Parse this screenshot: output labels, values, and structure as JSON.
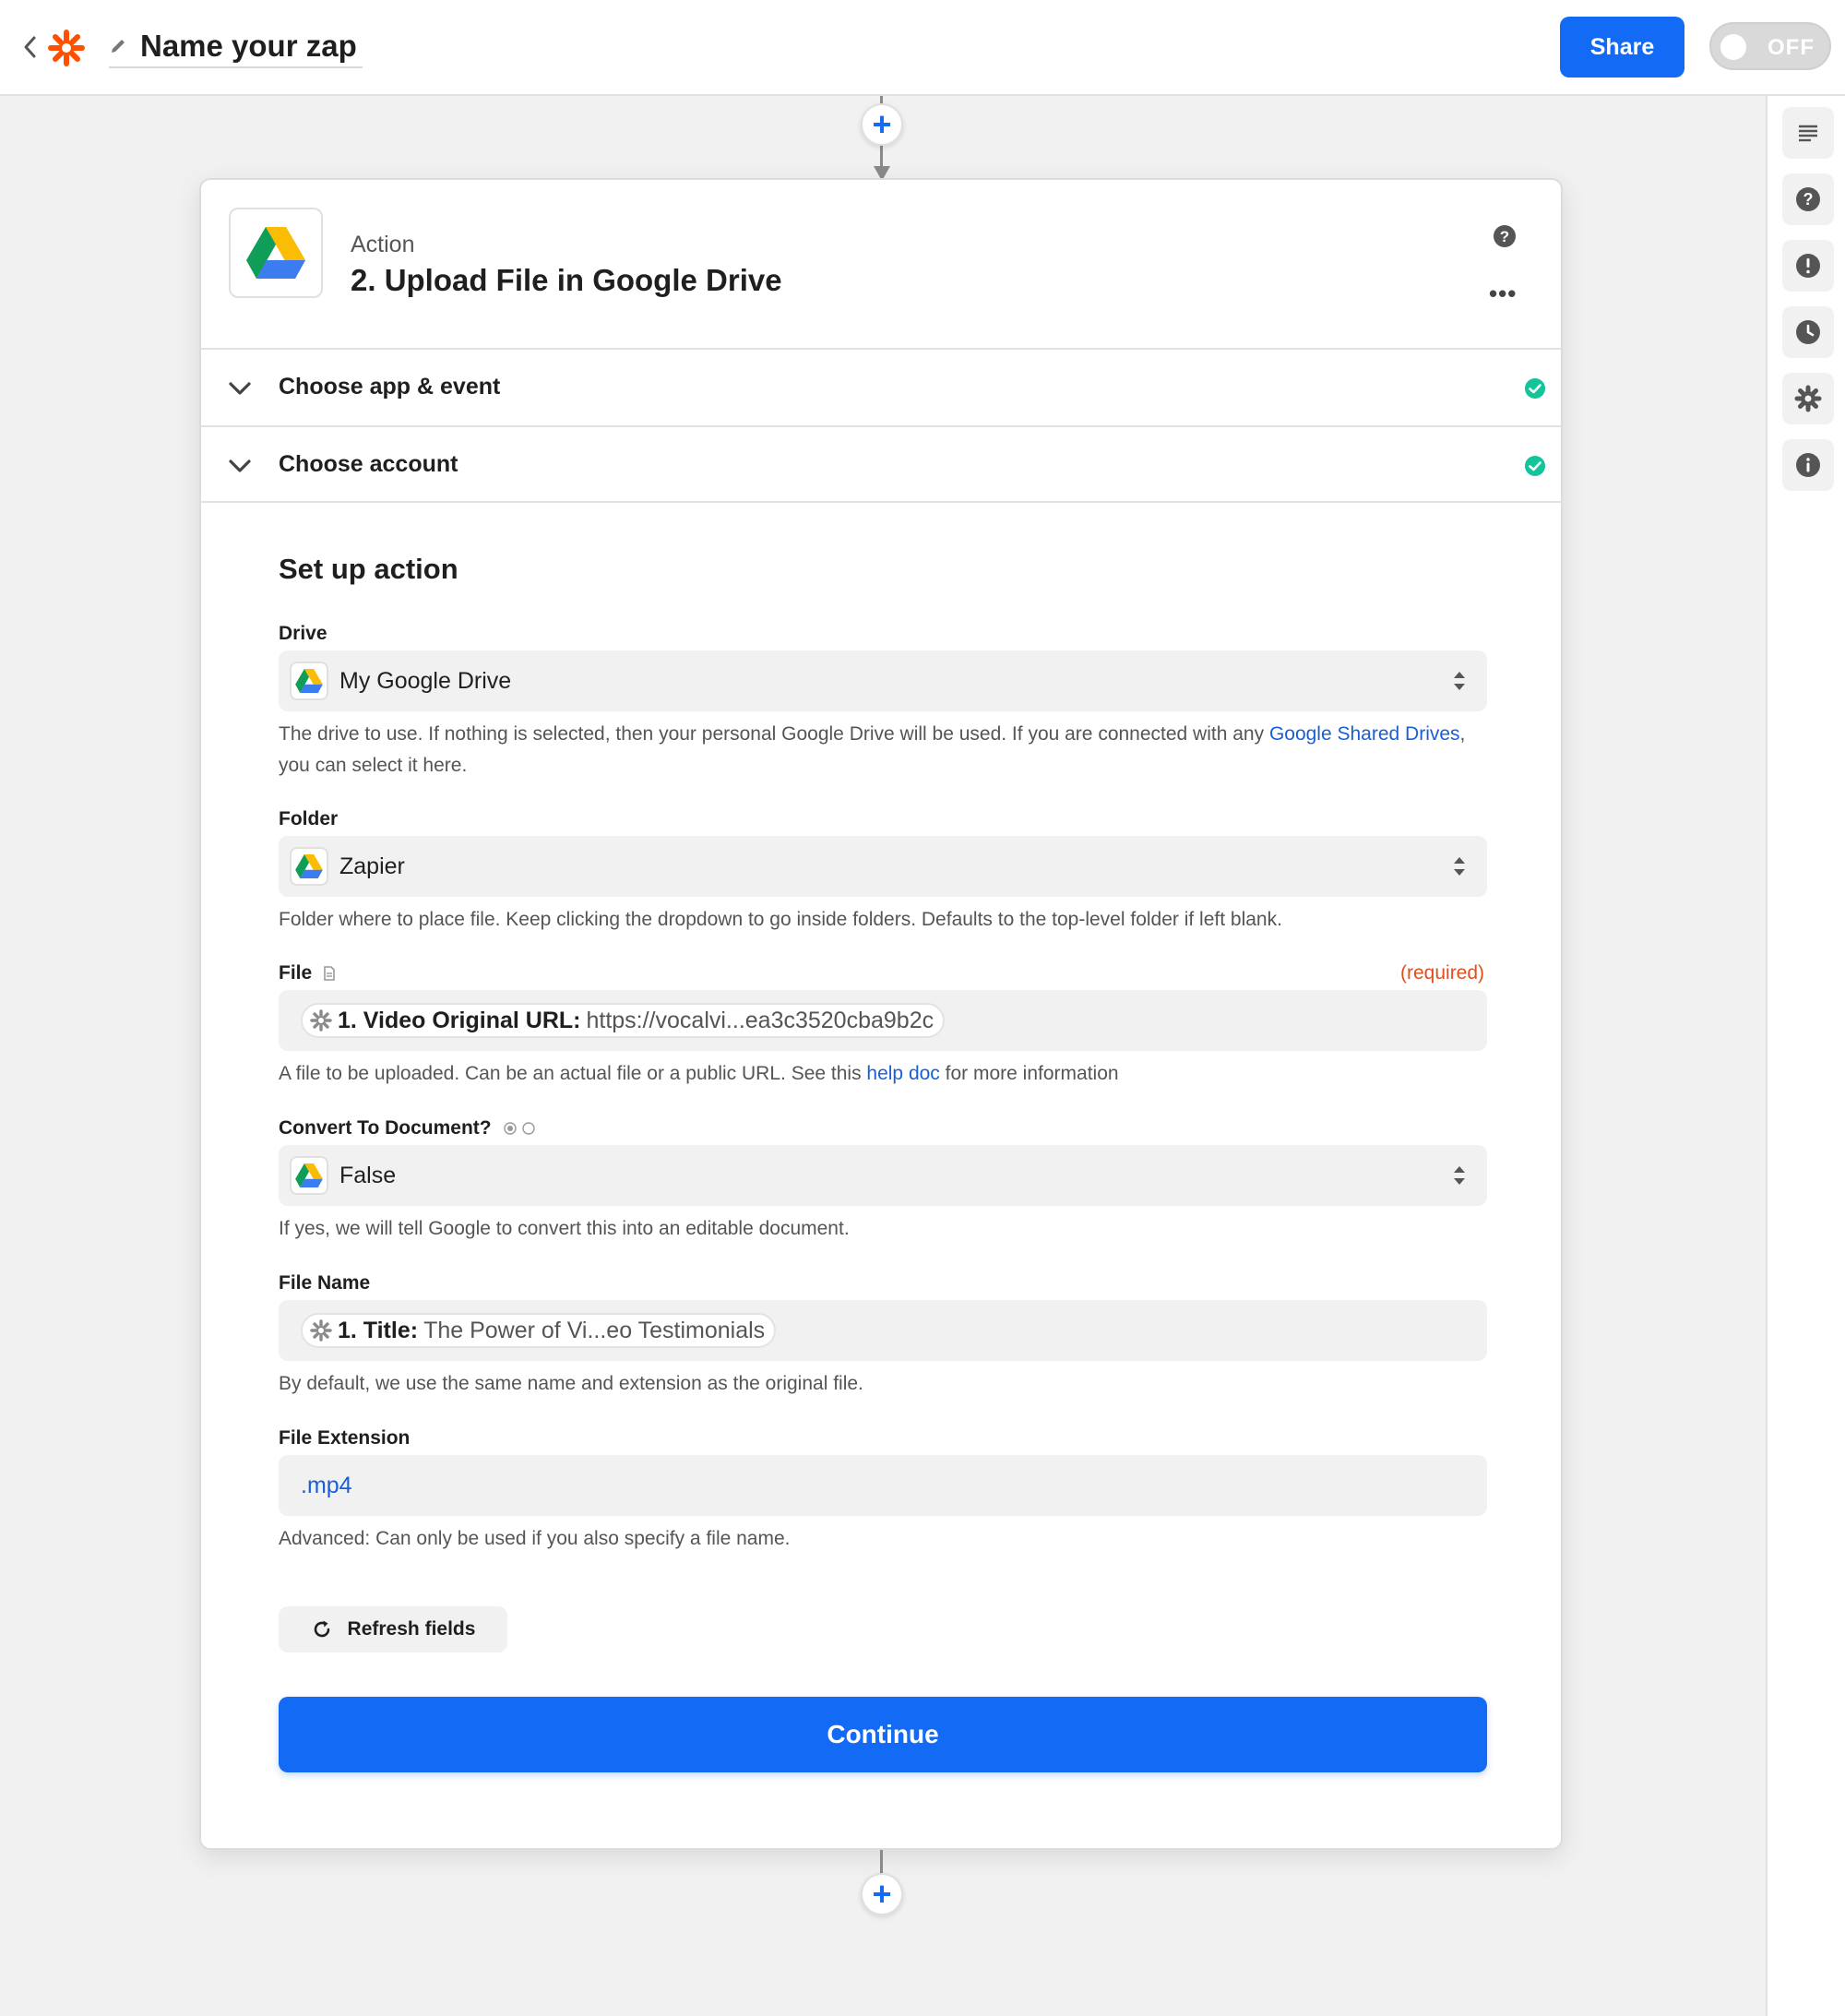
{
  "header": {
    "zap_title": "Name your zap",
    "share_label": "Share",
    "toggle_label": "OFF"
  },
  "colors": {
    "accent": "#136bf5",
    "brand_orange": "#ff4f00",
    "success": "#13c39a",
    "required": "#e0501e"
  },
  "rail": {
    "icons": [
      "outline-icon",
      "help-icon",
      "alert-icon",
      "history-icon",
      "settings-icon",
      "info-icon"
    ]
  },
  "step": {
    "kicker": "Action",
    "title": "2. Upload File in Google Drive",
    "app_icon": "google-drive-icon"
  },
  "accordion": [
    {
      "label": "Choose app & event",
      "status": "complete"
    },
    {
      "label": "Choose account",
      "status": "complete"
    }
  ],
  "setup": {
    "title": "Set up action",
    "drive": {
      "label": "Drive",
      "value": "My Google Drive",
      "help_before": "The drive to use. If nothing is selected, then your personal Google Drive will be used. If you are connected with any ",
      "help_link": "Google Shared Drives",
      "help_after": ", you can select it here."
    },
    "folder": {
      "label": "Folder",
      "value": "Zapier",
      "help": "Folder where to place file. Keep clicking the dropdown to go inside folders. Defaults to the top-level folder if left blank."
    },
    "file": {
      "label": "File",
      "required": "(required)",
      "pill_key": "1. Video Original URL:",
      "pill_value": "https://vocalvi...ea3c3520cba9b2c",
      "help_before": "A file to be uploaded. Can be an actual file or a public URL. See this ",
      "help_link": "help doc",
      "help_after": " for more information"
    },
    "convert": {
      "label": "Convert To Document?",
      "value": "False",
      "help": "If yes, we will tell Google to convert this into an editable document."
    },
    "file_name": {
      "label": "File Name",
      "pill_key": "1. Title:",
      "pill_value": "The Power of Vi...eo Testimonials",
      "help": "By default, we use the same name and extension as the original file."
    },
    "file_extension": {
      "label": "File Extension",
      "value": ".mp4",
      "help": "Advanced: Can only be used if you also specify a file name."
    },
    "refresh_label": "Refresh fields",
    "continue_label": "Continue"
  }
}
